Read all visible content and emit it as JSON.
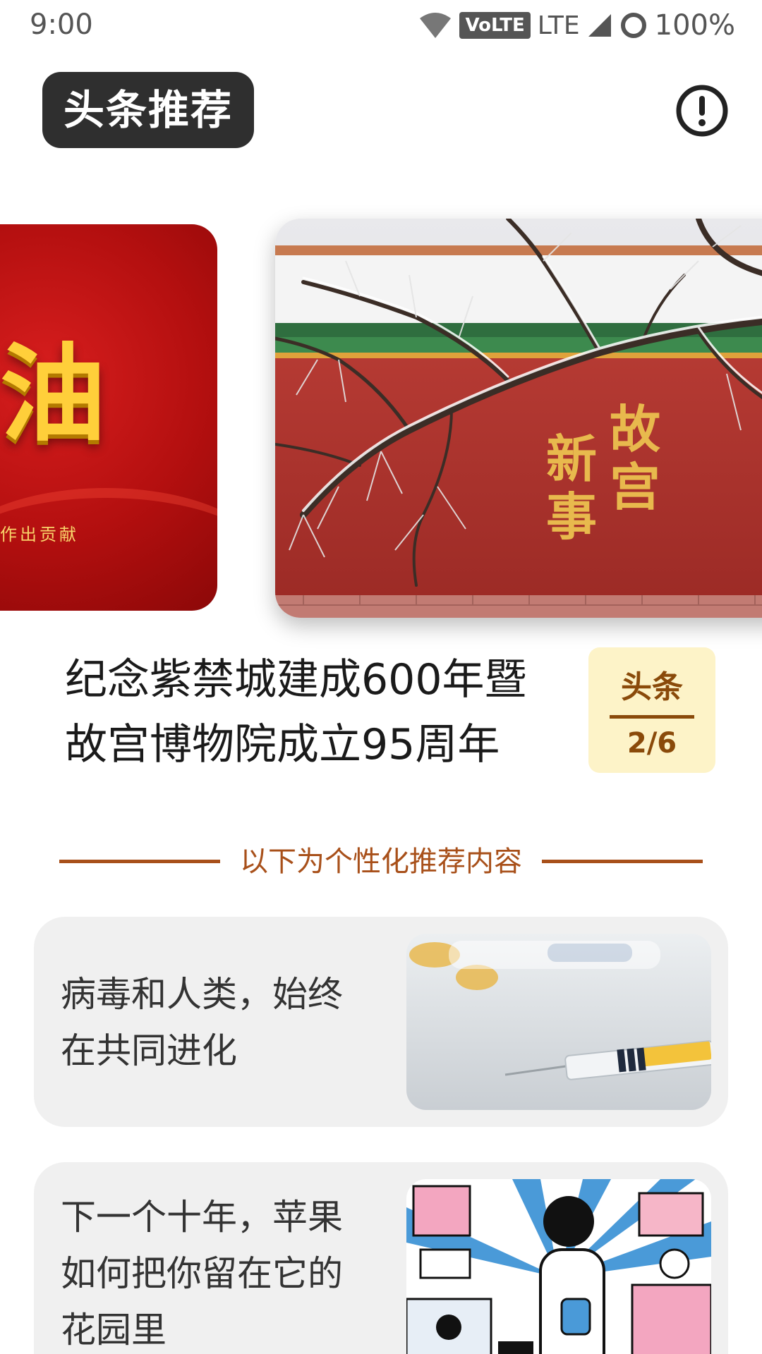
{
  "status_bar": {
    "time": "9:00",
    "volte": "VoLTE",
    "network": "LTE",
    "battery": "100%"
  },
  "header": {
    "title": "头条推荐",
    "info_icon": "exclamation-circle-icon"
  },
  "carousel": {
    "left_card": {
      "big_text": "油",
      "small_text": "作出贡献"
    },
    "main_card": {
      "calligraphy": [
        "故宫",
        "新事"
      ]
    }
  },
  "headline": {
    "text": "纪念紫禁城建成600年暨故宫博物院成立95周年",
    "badge_label": "头条",
    "badge_count": "2/6"
  },
  "divider": {
    "text": "以下为个性化推荐内容"
  },
  "news": [
    {
      "title": "病毒和人类，始终在共同进化"
    },
    {
      "title": "下一个十年，苹果如何把你留在它的花园里"
    }
  ],
  "colors": {
    "accent": "#a8501a",
    "badge_bg": "#fdf3c8",
    "pill_bg": "#2f2f2f",
    "card_bg": "#f0f0f0"
  }
}
